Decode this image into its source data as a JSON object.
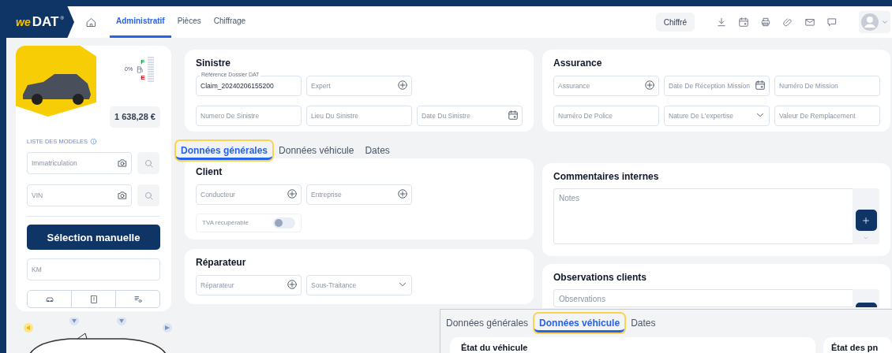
{
  "header": {
    "logo": {
      "script": "we",
      "word": "DAT",
      "mark": "®"
    },
    "nav": [
      {
        "label": "Administratif",
        "selected": true
      },
      {
        "label": "Pièces",
        "selected": false
      },
      {
        "label": "Chiffrage",
        "selected": false
      }
    ],
    "status": "Chiffré"
  },
  "vehicle_panel": {
    "fuel": {
      "reading": "0%",
      "full": "F",
      "empty": "E",
      "level": 0
    },
    "price": "1 638,28 €",
    "models_link": "LISTE DES MODELES",
    "lookups": [
      {
        "placeholder": "Immatriculation"
      },
      {
        "placeholder": "VIN"
      }
    ],
    "manual_button": "Sélection manuelle",
    "km": {
      "placeholder": "KM"
    }
  },
  "sinistre": {
    "title": "Sinistre",
    "rows": [
      [
        {
          "label": "Référence Dossier DAT",
          "value": "Claim_20240206155200",
          "kind": "text"
        },
        {
          "placeholder": "Expert",
          "kind": "add"
        }
      ],
      [
        {
          "placeholder": "Numero De Sinistre",
          "kind": "text"
        },
        {
          "placeholder": "Lieu Du Sinistre",
          "kind": "text"
        },
        {
          "placeholder": "Date Du Sinistre",
          "kind": "date"
        }
      ]
    ]
  },
  "assurance": {
    "title": "Assurance",
    "rows": [
      [
        {
          "placeholder": "Assurance",
          "kind": "add"
        },
        {
          "placeholder": "Date De Réception Mission",
          "kind": "date"
        },
        {
          "placeholder": "Numéro De Mission",
          "kind": "text"
        }
      ],
      [
        {
          "placeholder": "Numéro De Police",
          "kind": "text"
        },
        {
          "placeholder": "Nature De L'expertise",
          "kind": "select"
        },
        {
          "placeholder": "Valeur De Remplacement",
          "kind": "text"
        }
      ]
    ]
  },
  "tabs": [
    {
      "label": "Données générales",
      "selected": true
    },
    {
      "label": "Données véhicule",
      "selected": false
    },
    {
      "label": "Dates",
      "selected": false
    }
  ],
  "client": {
    "title": "Client",
    "rows": [
      [
        {
          "placeholder": "Conducteur",
          "kind": "add"
        },
        {
          "placeholder": "Entreprise",
          "kind": "add"
        }
      ]
    ],
    "toggle": {
      "label": "TVA récupérable",
      "on": false
    }
  },
  "reparateur": {
    "title": "Réparateur",
    "rows": [
      [
        {
          "placeholder": "Réparateur",
          "kind": "add"
        },
        {
          "placeholder": "Sous-Traitance",
          "kind": "select"
        }
      ]
    ]
  },
  "comments": {
    "title": "Commentaires internes",
    "placeholder": "Notes"
  },
  "observations": {
    "title": "Observations clients",
    "placeholder": "Observations"
  },
  "overlay": {
    "tabs": [
      {
        "label": "Données générales",
        "selected": false
      },
      {
        "label": "Données véhicule",
        "selected": true
      },
      {
        "label": "Dates",
        "selected": false
      }
    ],
    "cards": [
      {
        "title": "État du véhicule"
      },
      {
        "title": "État des pn"
      }
    ]
  }
}
